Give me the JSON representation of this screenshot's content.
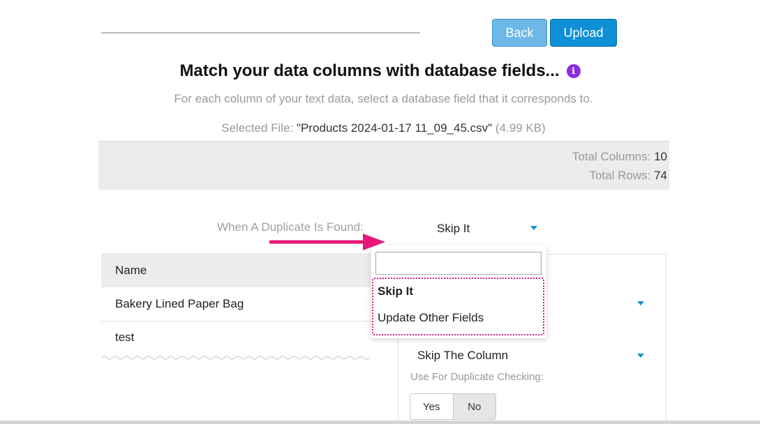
{
  "buttons": {
    "back": "Back",
    "upload": "Upload"
  },
  "header": {
    "title": "Match your data columns with database fields...",
    "subtitle": "For each column of your text data, select a database field that it corresponds to."
  },
  "file": {
    "prefix": "Selected File:",
    "name": "\"Products 2024-01-17 11_09_45.csv\"",
    "size": "(4.99 KB)"
  },
  "stats": {
    "columns_label": "Total Columns:",
    "columns_value": "10",
    "rows_label": "Total Rows:",
    "rows_value": "74"
  },
  "duplicate": {
    "label": "When A Duplicate Is Found:",
    "selected": "Skip It",
    "search_value": "",
    "options": [
      "Skip It",
      "Update Other Fields"
    ]
  },
  "table": {
    "header": "Name",
    "rows": [
      "Bakery Lined Paper Bag",
      "test"
    ]
  },
  "column_mapping": {
    "selected": "Skip The Column",
    "dup_check_label": "Use For Duplicate Checking:",
    "yes": "Yes",
    "no": "No"
  },
  "colors": {
    "accent": "#0e8fd6",
    "annotation": "#e6177a",
    "info": "#8e2de2"
  }
}
